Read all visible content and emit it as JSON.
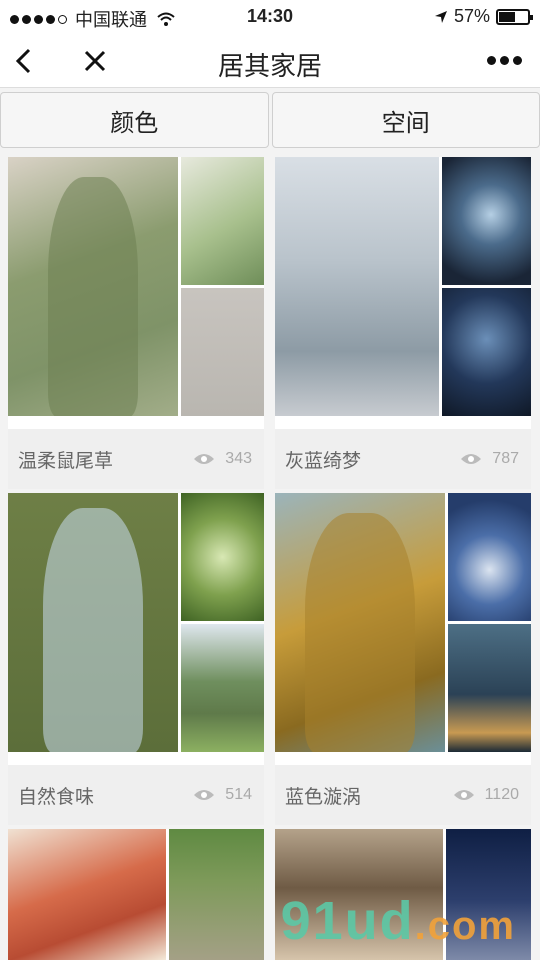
{
  "status_bar": {
    "carrier": "中国联通",
    "time": "14:30",
    "battery": "57%",
    "battery_level": 0.57
  },
  "nav": {
    "title": "居其家居"
  },
  "tabs": [
    {
      "label": "颜色"
    },
    {
      "label": "空间"
    }
  ],
  "cards": [
    {
      "name": "温柔鼠尾草",
      "views": "343"
    },
    {
      "name": "灰蓝绮梦",
      "views": "787"
    },
    {
      "name": "自然食味",
      "views": "514"
    },
    {
      "name": "蓝色漩涡",
      "views": "1120"
    },
    {
      "name": "",
      "views": ""
    },
    {
      "name": "",
      "views": ""
    }
  ],
  "watermark": {
    "main": "91ud",
    "suffix": ".com"
  },
  "icons": {
    "back": "chevron-left-icon",
    "close": "close-icon",
    "more": "more-dots-icon",
    "views": "eye-icon"
  },
  "colors": {
    "bar_bg": "#ffffff",
    "card_footer": "#efefef",
    "muted_text": "#666666"
  }
}
